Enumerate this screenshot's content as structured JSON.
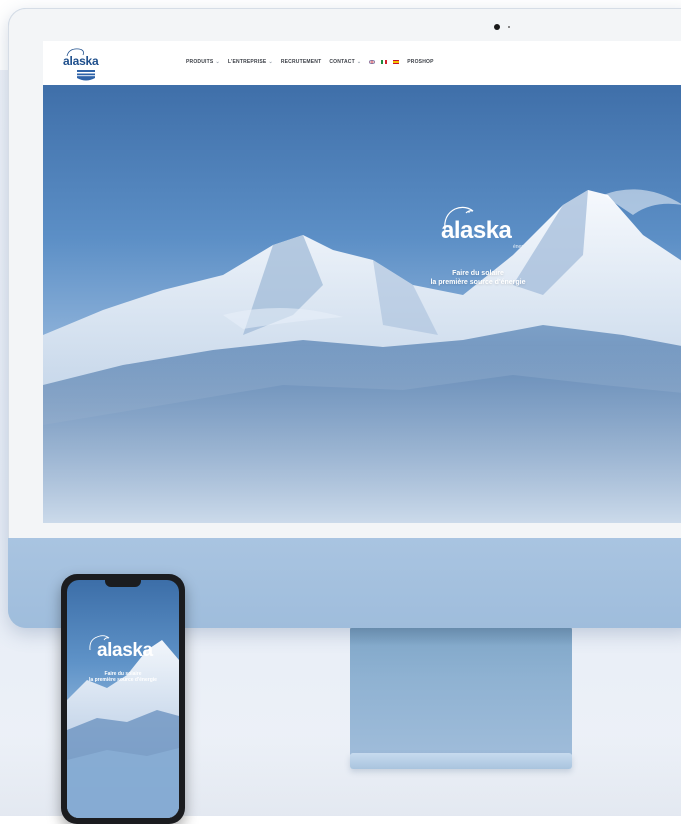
{
  "site": {
    "logo_text": "alaska",
    "nav": [
      {
        "label": "PRODUITS",
        "dropdown": true
      },
      {
        "label": "L'ENTREPRISE",
        "dropdown": true
      },
      {
        "label": "RECRUTEMENT",
        "dropdown": false
      },
      {
        "label": "CONTACT",
        "dropdown": true
      }
    ],
    "flags": [
      "uk-flag-icon",
      "italy-flag-icon",
      "spain-flag-icon"
    ],
    "proshop": "PROSHOP",
    "hero": {
      "brand": "alaska",
      "brand_sub": "énergies",
      "tagline_line1": "Faire du solaire",
      "tagline_line2": "la première source d'énergie"
    }
  },
  "phone": {
    "brand": "alaska",
    "tagline_line1": "Faire du solaire",
    "tagline_line2": "la première source d'énergie"
  },
  "colors": {
    "device_blue": "#a8c3e0",
    "brand_blue": "#1e4f8c",
    "sky_top": "#3f6fa9"
  }
}
